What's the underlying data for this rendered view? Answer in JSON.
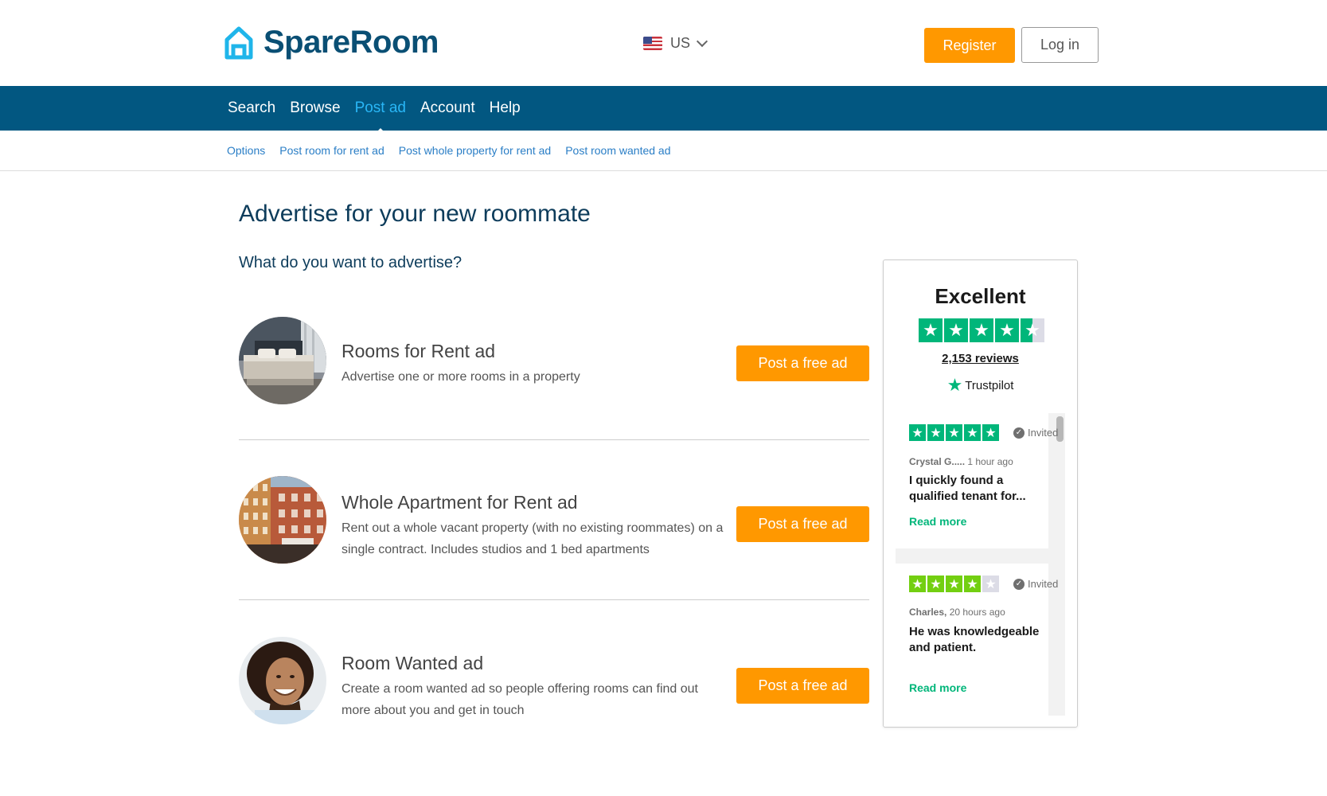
{
  "brand": {
    "name": "SpareRoom"
  },
  "header": {
    "locale": "US",
    "register_label": "Register",
    "login_label": "Log in"
  },
  "nav": {
    "items": [
      {
        "label": "Search",
        "active": false
      },
      {
        "label": "Browse",
        "active": false
      },
      {
        "label": "Post ad",
        "active": true
      },
      {
        "label": "Account",
        "active": false
      },
      {
        "label": "Help",
        "active": false
      }
    ]
  },
  "subnav": {
    "items": [
      {
        "label": "Options"
      },
      {
        "label": "Post room for rent ad"
      },
      {
        "label": "Post whole property for rent ad"
      },
      {
        "label": "Post room wanted ad"
      }
    ]
  },
  "main": {
    "title": "Advertise for your new roommate",
    "question": "What do you want to advertise?",
    "ads": [
      {
        "title": "Rooms for Rent ad",
        "description": "Advertise one or more rooms in a property",
        "button": "Post a free ad",
        "image": "bedroom-photo"
      },
      {
        "title": "Whole Apartment for Rent ad",
        "description": "Rent out a whole vacant property (with no existing roommates) on a single contract. Includes studios and 1 bed apartments",
        "button": "Post a free ad",
        "image": "apartment-building-photo"
      },
      {
        "title": "Room Wanted ad",
        "description": "Create a room wanted ad so people offering rooms can find out more about you and get in touch",
        "button": "Post a free ad",
        "image": "smiling-man-photo"
      }
    ]
  },
  "trustpilot": {
    "rating_word": "Excellent",
    "rating": 4.5,
    "reviews_count": "2,153 reviews",
    "logo_text": "Trustpilot",
    "reviews": [
      {
        "stars": 5,
        "invited": "Invited",
        "author": "Crystal G.....",
        "time": "1 hour ago",
        "text": "I quickly found a qualified tenant for...",
        "read_more": "Read more"
      },
      {
        "stars": 4,
        "invited": "Invited",
        "author": "Charles,",
        "time": "20 hours ago",
        "text": "He was knowledgeable and patient.",
        "read_more": "Read more"
      }
    ]
  },
  "colors": {
    "brand_blue": "#025781",
    "accent_orange": "#ff9800",
    "link_blue": "#2a7ec6",
    "trustpilot_green": "#00b67a"
  }
}
